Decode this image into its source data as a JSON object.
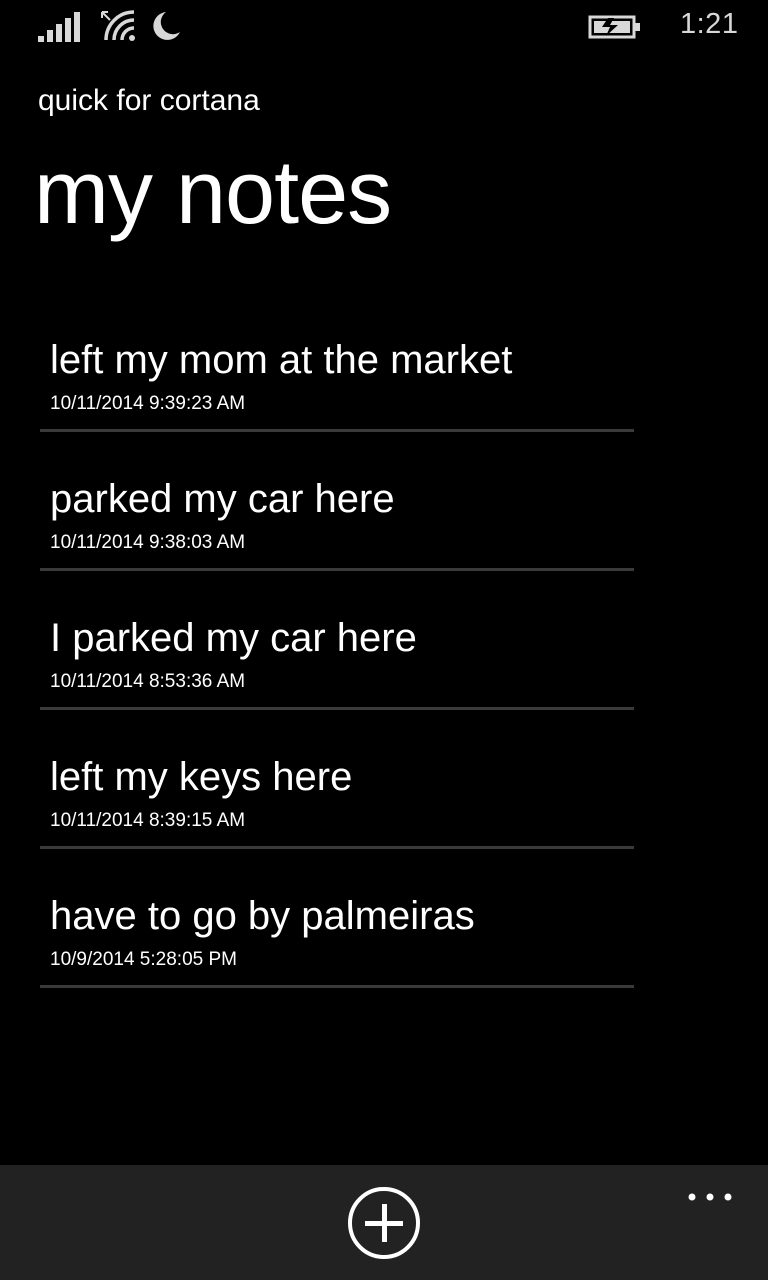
{
  "status_bar": {
    "time": "1:21",
    "icons": [
      "signal-icon",
      "wifi-icon",
      "quiet-hours-moon-icon",
      "battery-charging-icon"
    ]
  },
  "header": {
    "app_title": "quick for cortana",
    "page_title": "my notes"
  },
  "notes": [
    {
      "text": "left my mom at the market",
      "date": "10/11/2014 9:39:23 AM"
    },
    {
      "text": "parked my car here",
      "date": "10/11/2014 9:38:03 AM"
    },
    {
      "text": "I parked my car here",
      "date": "10/11/2014 8:53:36 AM"
    },
    {
      "text": "left my keys here",
      "date": "10/11/2014 8:39:15 AM"
    },
    {
      "text": "have to go by palmeiras",
      "date": "10/9/2014 5:28:05 PM"
    }
  ],
  "app_bar": {
    "icons": [
      "add-icon",
      "more-ellipsis-icon"
    ]
  },
  "colors": {
    "background": "#000000",
    "text": "#ffffff",
    "divider": "#3a3a3a",
    "app_bar": "#222222"
  }
}
